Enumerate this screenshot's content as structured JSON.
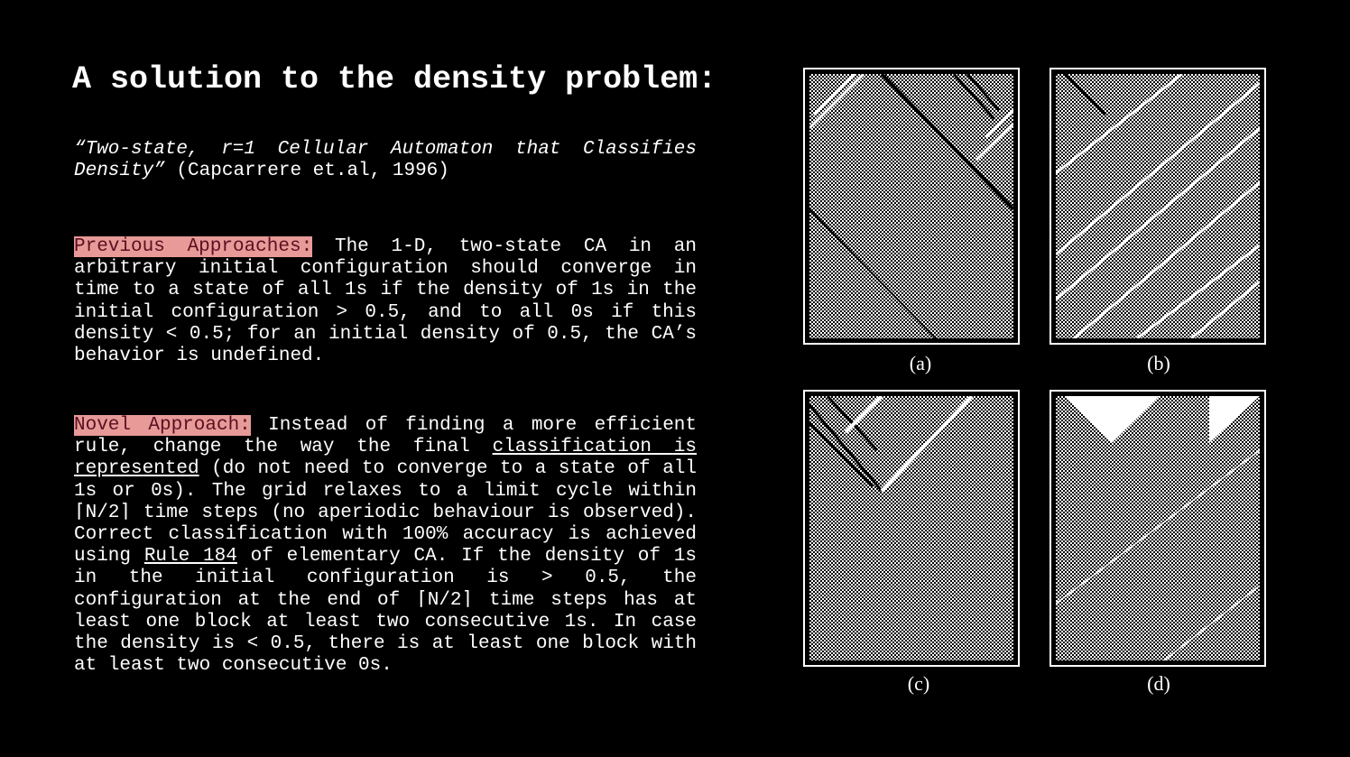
{
  "title": "A solution to the density problem:",
  "citation": {
    "lines": [
      [
        {
          "t": "“Two-state, r=1 Cellular Automaton that Classifies",
          "s": "it"
        }
      ],
      [
        {
          "t": "Density”",
          "s": "it"
        },
        {
          "t": " (Capcarrere et.al, 1996)"
        }
      ]
    ]
  },
  "previous": {
    "lines": [
      [
        {
          "t": "Previous Approaches:",
          "s": "hl"
        },
        {
          "t": " The 1-D, two-state CA in an"
        }
      ],
      [
        {
          "t": "arbitrary initial configuration should converge in"
        }
      ],
      [
        {
          "t": "time to a state of all 1s if the density of 1s in the"
        }
      ],
      [
        {
          "t": "initial configuration > 0.5, and to all 0s if this"
        }
      ],
      [
        {
          "t": "density < 0.5; for an initial density of 0.5, the CA’s"
        }
      ],
      [
        {
          "t": "behavior is undefined."
        }
      ]
    ]
  },
  "novel": {
    "lines": [
      [
        {
          "t": "Novel Approach:",
          "s": "hl"
        },
        {
          "t": " Instead of finding a more efficient"
        }
      ],
      [
        {
          "t": "rule, change the way the final "
        },
        {
          "t": "classification is ",
          "s": "ul"
        }
      ],
      [
        {
          "t": "represented",
          "s": "ul"
        },
        {
          "t": " (do not need to converge to a state of all"
        }
      ],
      [
        {
          "t": "1s or 0s). The grid relaxes to a limit cycle within"
        }
      ],
      [
        {
          "t": "⌈N/2⌉ time steps (no aperiodic behaviour is observed)."
        }
      ],
      [
        {
          "t": "Correct classification with 100% accuracy is achieved"
        }
      ],
      [
        {
          "t": "using "
        },
        {
          "t": "Rule 184",
          "s": "ul"
        },
        {
          "t": " of elementary CA. If the density of 1s"
        }
      ],
      [
        {
          "t": "in the initial configuration is > 0.5, the"
        }
      ],
      [
        {
          "t": "configuration at the end of ⌈N/2⌉ time steps has at"
        }
      ],
      [
        {
          "t": "least one block at least two consecutive 1s. In case"
        }
      ],
      [
        {
          "t": "the density is < 0.5, there is at least one block with"
        }
      ],
      [
        {
          "t": "at least two consecutive 0s."
        }
      ]
    ]
  },
  "figures": [
    {
      "caption": "(a)"
    },
    {
      "caption": "(b)"
    },
    {
      "caption": "(c)"
    },
    {
      "caption": "(d)"
    }
  ]
}
